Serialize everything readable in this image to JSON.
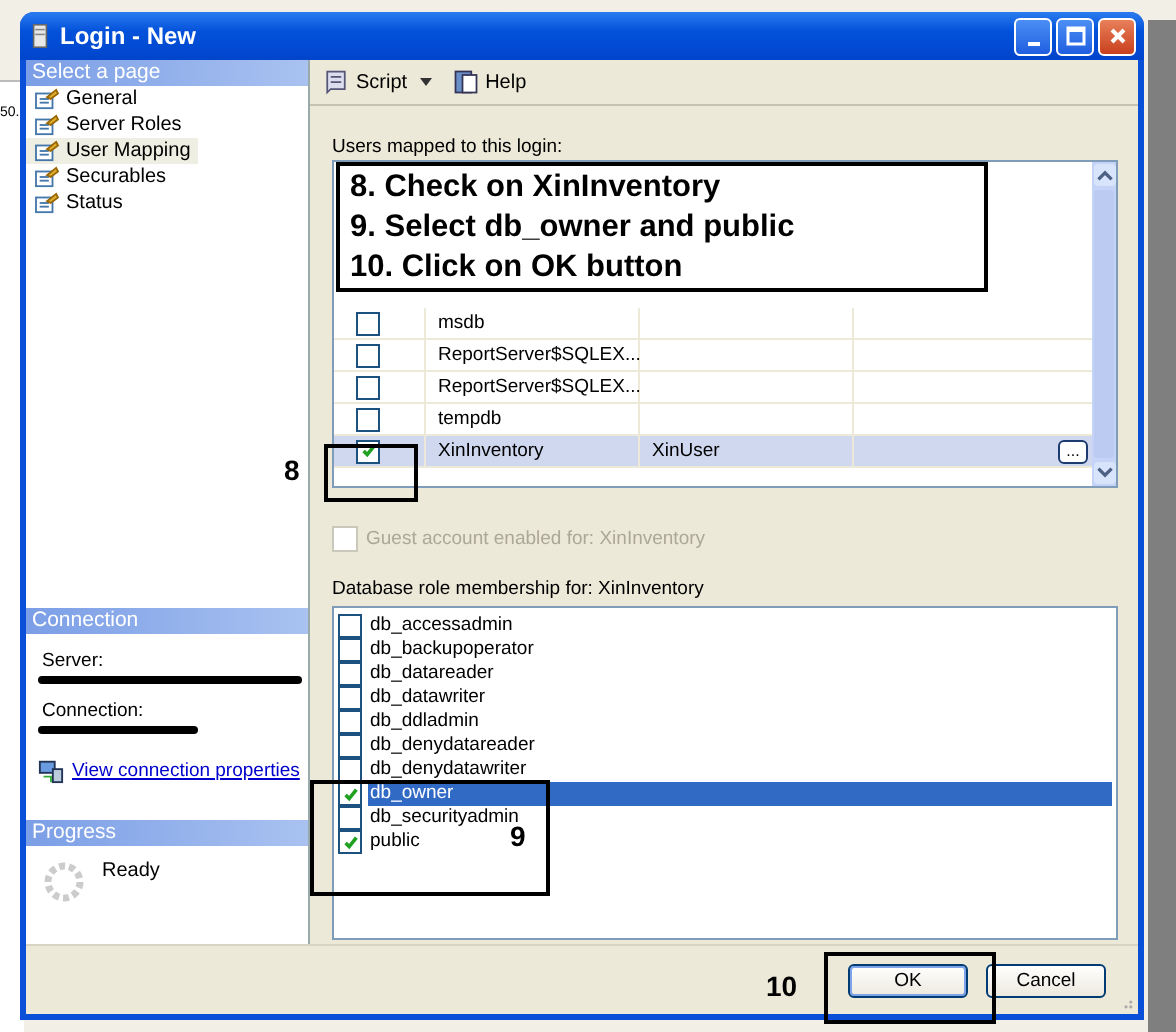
{
  "background": {
    "fragment": "50."
  },
  "window": {
    "title": "Login - New"
  },
  "sidebar": {
    "header": "Select a page",
    "items": [
      {
        "label": "General",
        "selected": false
      },
      {
        "label": "Server Roles",
        "selected": false
      },
      {
        "label": "User Mapping",
        "selected": true
      },
      {
        "label": "Securables",
        "selected": false
      },
      {
        "label": "Status",
        "selected": false
      }
    ]
  },
  "connection": {
    "header": "Connection",
    "server_label": "Server:",
    "connection_label": "Connection:",
    "link": "View connection properties"
  },
  "progress": {
    "header": "Progress",
    "status": "Ready"
  },
  "toolbar": {
    "script": "Script",
    "help": "Help"
  },
  "users": {
    "label": "Users mapped to this login:",
    "rows": [
      {
        "database": "msdb",
        "checked": false,
        "selected": false
      },
      {
        "database": "ReportServer$SQLEX...",
        "checked": false,
        "selected": false
      },
      {
        "database": "ReportServer$SQLEX...",
        "checked": false,
        "selected": false
      },
      {
        "database": "tempdb",
        "checked": false,
        "selected": false
      },
      {
        "database": "XinInventory",
        "user": "XinUser",
        "browse": "...",
        "checked": true,
        "selected": true
      }
    ]
  },
  "guest": {
    "label": "Guest account enabled for: XinInventory",
    "checked": false,
    "disabled": true
  },
  "roles": {
    "label": "Database role membership for: XinInventory",
    "items": [
      {
        "label": "db_accessadmin",
        "checked": false,
        "selected": false
      },
      {
        "label": "db_backupoperator",
        "checked": false,
        "selected": false
      },
      {
        "label": "db_datareader",
        "checked": false,
        "selected": false
      },
      {
        "label": "db_datawriter",
        "checked": false,
        "selected": false
      },
      {
        "label": "db_ddladmin",
        "checked": false,
        "selected": false
      },
      {
        "label": "db_denydatareader",
        "checked": false,
        "selected": false
      },
      {
        "label": "db_denydatawriter",
        "checked": false,
        "selected": false
      },
      {
        "label": "db_owner",
        "checked": true,
        "selected": true
      },
      {
        "label": "db_securityadmin",
        "checked": false,
        "selected": false
      },
      {
        "label": "public",
        "checked": true,
        "selected": false
      }
    ]
  },
  "buttons": [
    {
      "label": "OK",
      "default": true
    },
    {
      "label": "Cancel",
      "default": false
    }
  ],
  "annotations": {
    "instructions": [
      "8. Check on XinInventory",
      "9. Select db_owner and public",
      "10. Click on OK button"
    ],
    "markers": [
      "8",
      "9",
      "10"
    ]
  }
}
